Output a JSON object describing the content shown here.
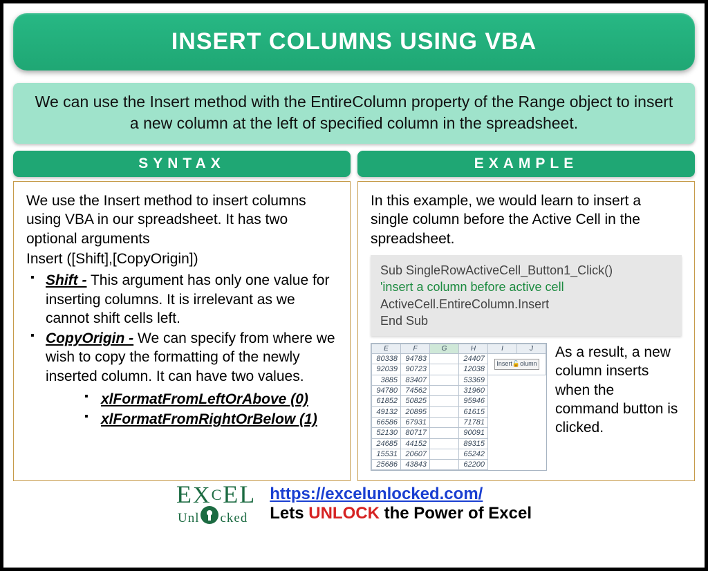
{
  "title": "INSERT COLUMNS USING VBA",
  "intro": "We can use the Insert method with the EntireColumn property of the Range object to insert a new column at the left of specified column in the spreadsheet.",
  "syntax": {
    "header": "SYNTAX",
    "intro1": "We use the Insert method to insert columns using VBA in our spreadsheet. It has two optional arguments",
    "intro2": "Insert ([Shift],[CopyOrigin])",
    "arg1_name": "Shift -",
    "arg1_desc": " This argument has only one value for inserting columns. It is irrelevant as we cannot shift cells left.",
    "arg2_name": "CopyOrigin -",
    "arg2_desc": " We can specify from where we wish to copy the formatting of the newly inserted column. It can have two values.",
    "val1": "xlFormatFromLeftOrAbove (0)",
    "val2": "xlFormatFromRightOrBelow (1)"
  },
  "example": {
    "header": "EXAMPLE",
    "intro": "In this example, we would learn to insert a single column before the Active Cell in the spreadsheet.",
    "code_line1": "Sub SingleRowActiveCell_Button1_Click()",
    "code_line2": "'insert a column before active cell",
    "code_line3": "ActiveCell.EntireColumn.Insert",
    "code_line4": "End Sub",
    "result": "As a result, a new column inserts when the command button is clicked.",
    "button_text": "Insert🔓olumn",
    "sheet_headers": [
      "E",
      "F",
      "G",
      "H",
      "I",
      "J"
    ],
    "sheet_rows": [
      [
        "80338",
        "94783",
        "",
        "24407"
      ],
      [
        "92039",
        "90723",
        "",
        "12038"
      ],
      [
        "3885",
        "83407",
        "",
        "53369"
      ],
      [
        "94780",
        "74562",
        "",
        "31960"
      ],
      [
        "61852",
        "50825",
        "",
        "95946"
      ],
      [
        "49132",
        "20895",
        "",
        "61615"
      ],
      [
        "66586",
        "67931",
        "",
        "71781"
      ],
      [
        "52130",
        "80717",
        "",
        "90091"
      ],
      [
        "24685",
        "44152",
        "",
        "89315"
      ],
      [
        "15531",
        "20607",
        "",
        "65242"
      ],
      [
        "25686",
        "43843",
        "",
        "62200"
      ]
    ]
  },
  "footer": {
    "logo_top": "EXᴄEL",
    "logo_bottom": "Unlocked",
    "link": "https://excelunlocked.com/",
    "tag_before": "Lets ",
    "tag_unlock": "UNLOCK",
    "tag_after": " the Power of Excel"
  }
}
